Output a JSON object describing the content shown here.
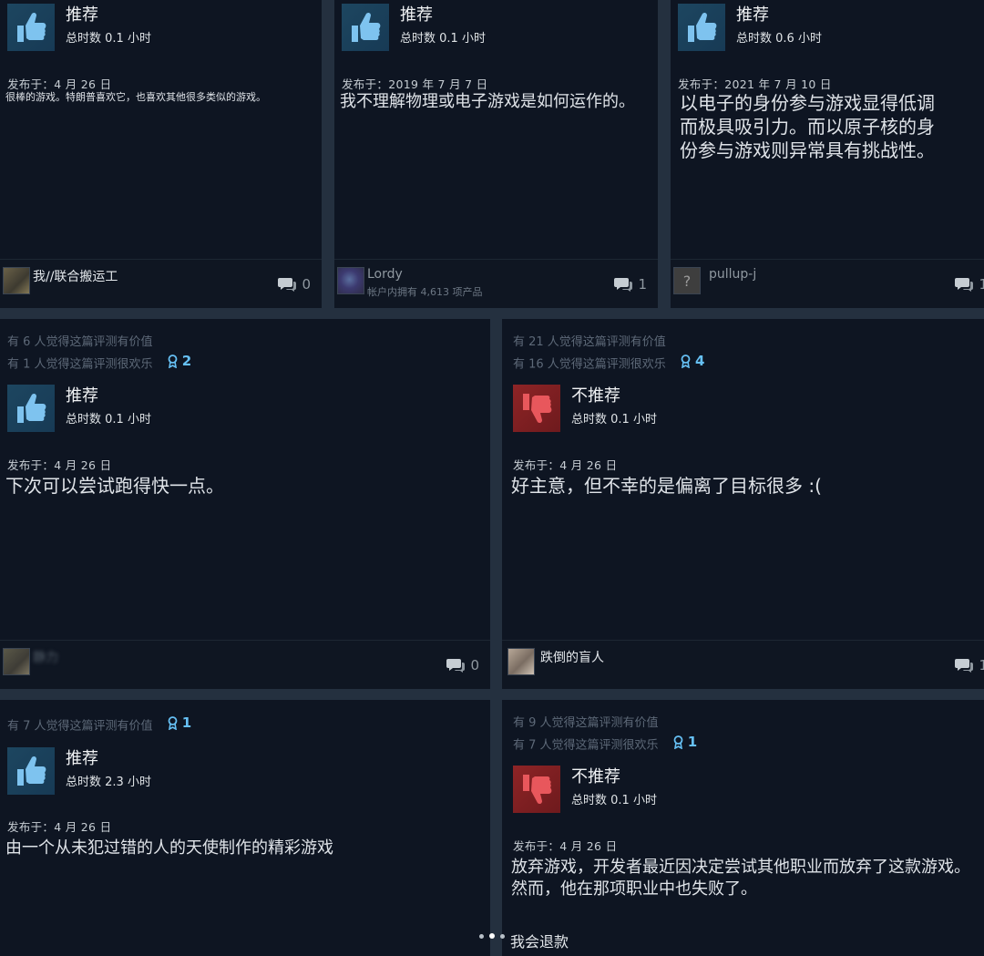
{
  "reviews": [
    {
      "helpful": "",
      "funny": "",
      "awards": "",
      "verdict": "推荐",
      "hours": "总时数 0.1 小时",
      "posted": "发布于：4 月 26 日",
      "text": "很棒的游戏。特朗普喜欢它，也喜欢其他很多类似的游戏。",
      "author": "我//联合搬运工",
      "author_sub": "",
      "comments": "0"
    },
    {
      "helpful": "",
      "funny": "",
      "awards": "",
      "verdict": "推荐",
      "hours": "总时数 0.1 小时",
      "posted": "发布于：2019 年 7 月 7 日",
      "text": "我不理解物理或电子游戏是如何运作的。",
      "author": "Lordy",
      "author_sub": "帐户内拥有 4,613 项产品",
      "comments": "1"
    },
    {
      "helpful": "",
      "funny": "",
      "awards": "",
      "verdict": "推荐",
      "hours": "总时数 0.6 小时",
      "posted": "发布于：2021 年 7 月 10 日",
      "text": "以电子的身份参与游戏显得低调而极具吸引力。而以原子核的身份参与游戏则异常具有挑战性。",
      "author": "pullup-j",
      "author_sub": "",
      "comments": "1"
    },
    {
      "helpful": "有 6 人觉得这篇评测有价值",
      "funny": "有 1 人觉得这篇评测很欢乐",
      "awards": "2",
      "verdict": "推荐",
      "hours": "总时数 0.1 小时",
      "posted": "发布于：4 月 26 日",
      "text": "下次可以尝试跑得快一点。",
      "author": "静力",
      "author_sub": "",
      "comments": "0"
    },
    {
      "helpful": "有 21 人觉得这篇评测有价值",
      "funny": "有 16 人觉得这篇评测很欢乐",
      "awards": "4",
      "verdict": "不推荐",
      "hours": "总时数 0.1 小时",
      "posted": "发布于：4 月 26 日",
      "text": "好主意，但不幸的是偏离了目标很多 :(",
      "author": "跌倒的盲人",
      "author_sub": "",
      "comments": "1"
    },
    {
      "helpful": "有 7 人觉得这篇评测有价值",
      "funny": "",
      "awards": "1",
      "verdict": "推荐",
      "hours": "总时数 2.3 小时",
      "posted": "发布于：4 月 26 日",
      "text": "由一个从未犯过错的人的天使制作的精彩游戏",
      "author": "",
      "author_sub": "",
      "comments": ""
    },
    {
      "helpful": "有 9 人觉得这篇评测有价值",
      "funny": "有 7 人觉得这篇评测很欢乐",
      "awards": "1",
      "verdict": "不推荐",
      "hours": "总时数 0.1 小时",
      "posted": "发布于：4 月 26 日",
      "text": "放弃游戏，开发者最近因决定尝试其他职业而放弃了这款游戏。然而，他在那项职业中也失败了。",
      "author": "",
      "author_sub": "",
      "comments": ""
    }
  ],
  "refund_text": "我会退款",
  "colors": {
    "background": "#0e1522",
    "recommend": "#1d4660",
    "not_recommend": "#8e2426",
    "award": "#66c0f4"
  }
}
